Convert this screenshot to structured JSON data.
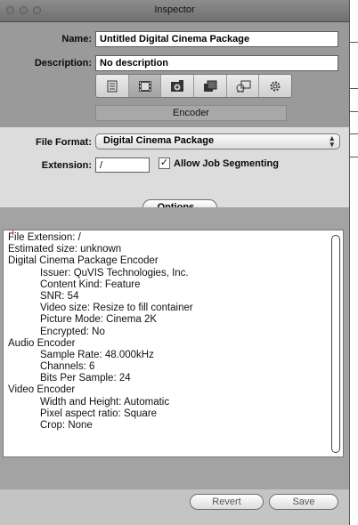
{
  "window": {
    "title": "Inspector"
  },
  "fields": {
    "name_label": "Name:",
    "name_value": "Untitled Digital Cinema Package",
    "description_label": "Description:",
    "description_value": "No description"
  },
  "tabs": [
    {
      "icon": "summary-icon",
      "selected": false
    },
    {
      "icon": "encoder-film-icon",
      "selected": true
    },
    {
      "icon": "frame-controls-icon",
      "selected": false
    },
    {
      "icon": "geometry-icon",
      "selected": false
    },
    {
      "icon": "filters-icon",
      "selected": false
    },
    {
      "icon": "actions-gear-icon",
      "selected": false
    }
  ],
  "encoder_label": "Encoder",
  "format": {
    "label": "File Format:",
    "value": "Digital Cinema Package",
    "extension_label": "Extension:",
    "extension_value": "/",
    "segment_label": "Allow Job Segmenting",
    "segment_checked": true,
    "options_button": "Options..."
  },
  "summary_lines": [
    {
      "text": "File Extension: /",
      "indent": false
    },
    {
      "text": "Estimated size: unknown",
      "indent": false
    },
    {
      "text": "Digital Cinema Package Encoder",
      "indent": false
    },
    {
      "text": "Issuer: QuVIS Technologies, Inc.",
      "indent": true
    },
    {
      "text": "Content Kind: Feature",
      "indent": true
    },
    {
      "text": "SNR: 54",
      "indent": true
    },
    {
      "text": "Video size: Resize to fill container",
      "indent": true
    },
    {
      "text": "Picture Mode: Cinema 2K",
      "indent": true
    },
    {
      "text": "Encrypted: No",
      "indent": true
    },
    {
      "text": "Audio Encoder",
      "indent": false
    },
    {
      "text": "Sample Rate: 48.000kHz",
      "indent": true
    },
    {
      "text": "Channels: 6",
      "indent": true
    },
    {
      "text": "Bits Per Sample: 24",
      "indent": true
    },
    {
      "text": "Video Encoder",
      "indent": false
    },
    {
      "text": "Width and Height: Automatic",
      "indent": true
    },
    {
      "text": "Pixel aspect ratio: Square",
      "indent": true
    },
    {
      "text": "Crop: None",
      "indent": true
    }
  ],
  "buttons": {
    "revert": "Revert",
    "save": "Save"
  }
}
